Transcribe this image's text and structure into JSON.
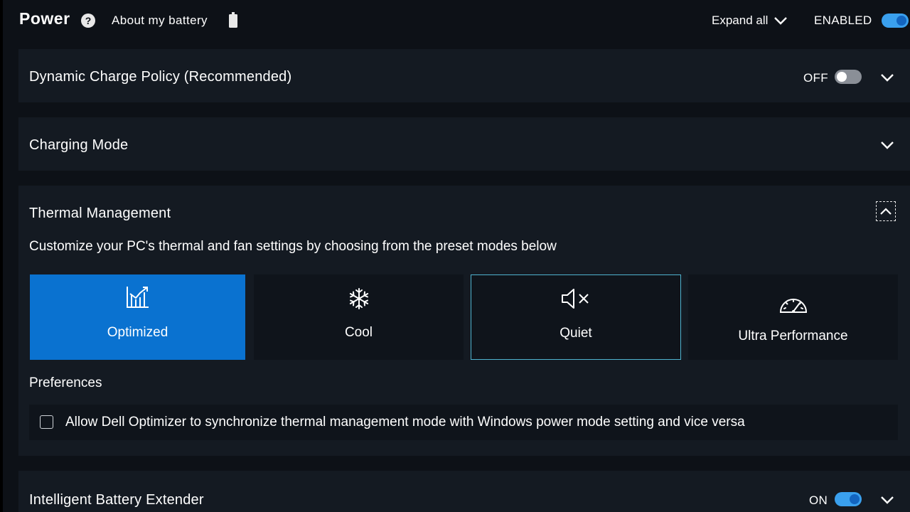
{
  "header": {
    "title": "Power",
    "about_link": "About my battery",
    "expand_all": "Expand all",
    "enabled_label": "ENABLED"
  },
  "sections": {
    "dynamic_charge": {
      "title": "Dynamic Charge Policy (Recommended)",
      "state": "OFF"
    },
    "charging_mode": {
      "title": "Charging Mode"
    },
    "thermal": {
      "title": "Thermal Management",
      "description": "Customize your PC's thermal and fan settings by choosing from the preset modes below",
      "modes": [
        {
          "label": "Optimized",
          "icon": "optimized-chart-icon",
          "selected": true
        },
        {
          "label": "Cool",
          "icon": "snowflake-icon"
        },
        {
          "label": "Quiet",
          "icon": "speaker-mute-icon",
          "focused": true
        },
        {
          "label": "Ultra Performance",
          "icon": "speedometer-icon"
        }
      ],
      "preferences_label": "Preferences",
      "sync_checkbox_label": "Allow Dell Optimizer to synchronize thermal management mode with Windows power mode setting and vice versa"
    },
    "battery_extender": {
      "title": "Intelligent Battery Extender",
      "state": "ON"
    }
  },
  "colors": {
    "background": "#0d1117",
    "panel": "#141a22",
    "card": "#0f141b",
    "accent": "#0a72d0",
    "toggle_on": "#3aa0ee",
    "focus_outline": "#4fb3cf"
  }
}
